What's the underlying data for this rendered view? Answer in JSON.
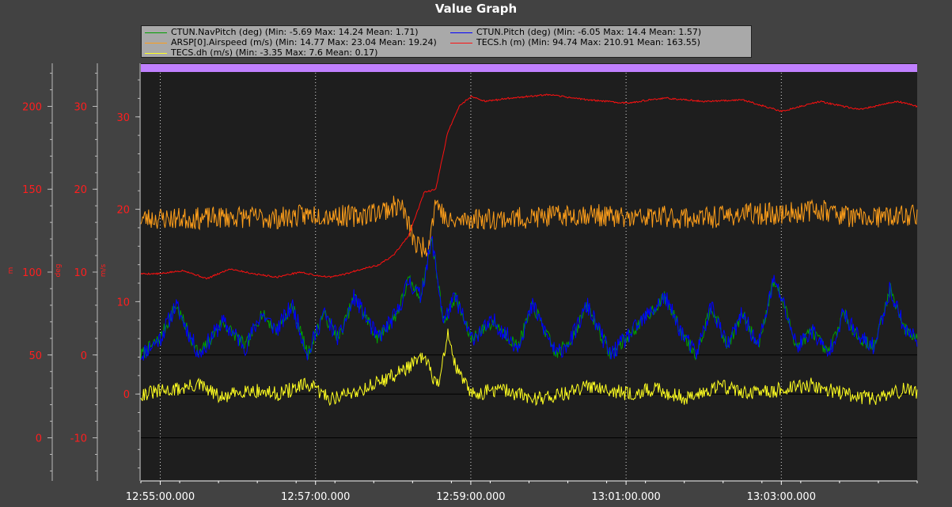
{
  "window": {
    "title": "Value Graph"
  },
  "colors": {
    "background": "#424242",
    "plot_bg": "#1e1e1e",
    "grid": "#d8d8d8",
    "axis_text": "#ff1e1e",
    "x_text": "#ffffff",
    "purple_band": "#c080ff"
  },
  "legend": [
    {
      "text": "CTUN.NavPitch (deg)  (Min: -5.69 Max: 14.24 Mean: 1.71)",
      "color": "#00a000"
    },
    {
      "text": "CTUN.Pitch (deg)  (Min: -6.05 Max: 14.4 Mean: 1.57)",
      "color": "#0000ff"
    },
    {
      "text": "ARSP[0].Airspeed (m/s)  (Min: 14.77 Max: 23.04 Mean: 19.24)",
      "color": "#ff9f1a"
    },
    {
      "text": "TECS.h (m)  (Min: 94.74 Max: 210.91 Mean: 163.55)",
      "color": "#ff1010"
    },
    {
      "text": "TECS.dh (m/s)  (Min: -3.35 Max: 7.6 Mean: 0.17)",
      "color": "#ffff20"
    }
  ],
  "chart_data": {
    "type": "line",
    "title": "Value Graph",
    "x_labels": [
      "12:55:00.000",
      "12:57:00.000",
      "12:59:00.000",
      "13:01:00.000",
      "13:03:00.000"
    ],
    "x_label_minutes": [
      0,
      2,
      4,
      6,
      8
    ],
    "x_range_minutes": [
      -0.25,
      9.75
    ],
    "axes": {
      "m": {
        "label": "m",
        "ticks": [
          0,
          50,
          100,
          150,
          200
        ],
        "range": [
          -26,
          226
        ]
      },
      "deg": {
        "label": "deg",
        "ticks": [
          -10,
          0,
          10,
          20,
          30
        ],
        "range": [
          -15.2,
          35.2
        ]
      },
      "m/s": {
        "label": "m/s",
        "ticks": [
          0,
          10,
          20,
          30
        ],
        "range": [
          -9.4,
          35.8
        ]
      }
    },
    "series": [
      {
        "name": "CTUN.NavPitch (deg)",
        "axis": "deg",
        "color": "#00a000",
        "noise": 0.8,
        "seed": 7,
        "t": [
          -0.25,
          0.0,
          0.2,
          0.5,
          0.8,
          1.1,
          1.3,
          1.5,
          1.7,
          1.9,
          2.1,
          2.3,
          2.5,
          2.8,
          3.05,
          3.2,
          3.35,
          3.5,
          3.65,
          3.8,
          4.0,
          4.3,
          4.6,
          4.8,
          5.1,
          5.3,
          5.5,
          5.8,
          6.0,
          6.3,
          6.5,
          6.7,
          6.9,
          7.1,
          7.3,
          7.5,
          7.7,
          7.9,
          8.0,
          8.2,
          8.4,
          8.6,
          8.8,
          9.0,
          9.2,
          9.4,
          9.6,
          9.75
        ],
        "v": [
          0,
          2,
          6,
          0,
          4,
          1,
          5,
          3,
          6,
          0,
          5,
          2,
          7,
          2,
          5,
          9,
          7,
          14,
          4,
          7,
          2,
          4,
          1,
          6,
          0,
          2,
          6,
          0,
          2,
          5,
          7,
          3,
          0,
          6,
          1,
          5,
          1,
          9,
          7,
          1,
          3,
          0,
          5,
          2,
          1,
          8,
          3,
          2
        ]
      },
      {
        "name": "CTUN.Pitch (deg)",
        "axis": "deg",
        "color": "#0000ff",
        "noise": 1.1,
        "seed": 11,
        "t": [
          -0.25,
          0.0,
          0.2,
          0.5,
          0.8,
          1.1,
          1.3,
          1.5,
          1.7,
          1.9,
          2.1,
          2.3,
          2.5,
          2.8,
          3.05,
          3.2,
          3.35,
          3.5,
          3.65,
          3.8,
          4.0,
          4.3,
          4.6,
          4.8,
          5.1,
          5.3,
          5.5,
          5.8,
          6.0,
          6.3,
          6.5,
          6.7,
          6.9,
          7.1,
          7.3,
          7.5,
          7.7,
          7.9,
          8.0,
          8.2,
          8.4,
          8.6,
          8.8,
          9.0,
          9.2,
          9.4,
          9.6,
          9.75
        ],
        "v": [
          0,
          2,
          6,
          0,
          4,
          1,
          5,
          3,
          6,
          0,
          5,
          2,
          7,
          2,
          5,
          9,
          7,
          14,
          4,
          7,
          2,
          4,
          1,
          6,
          0,
          2,
          6,
          0,
          2,
          5,
          7,
          3,
          0,
          6,
          1,
          5,
          1,
          9,
          7,
          1,
          3,
          0,
          5,
          2,
          1,
          8,
          3,
          2
        ]
      },
      {
        "name": "ARSP[0].Airspeed (m/s)",
        "axis": "m/s",
        "color": "#ff9f1a",
        "noise": 1.2,
        "seed": 23,
        "t": [
          -0.25,
          0.5,
          1.0,
          1.5,
          2.0,
          2.5,
          2.9,
          3.1,
          3.3,
          3.45,
          3.55,
          3.7,
          4.0,
          4.5,
          5.0,
          5.5,
          6.0,
          6.5,
          7.0,
          7.5,
          8.0,
          8.5,
          9.0,
          9.5,
          9.75
        ],
        "v": [
          19,
          19,
          19.2,
          19,
          19.5,
          19.2,
          20,
          20.5,
          16,
          16,
          21,
          18.5,
          19,
          19,
          19.2,
          19.5,
          19,
          19.2,
          19,
          19.5,
          19.5,
          20,
          19,
          19.2,
          19.5
        ]
      },
      {
        "name": "TECS.h (m)",
        "axis": "m",
        "color": "#ff1010",
        "noise": 0.5,
        "seed": 5,
        "t": [
          -0.25,
          0.0,
          0.3,
          0.6,
          0.9,
          1.2,
          1.5,
          1.8,
          2.0,
          2.2,
          2.4,
          2.6,
          2.8,
          3.0,
          3.2,
          3.4,
          3.55,
          3.7,
          3.85,
          4.0,
          4.2,
          4.5,
          5.0,
          5.5,
          6.0,
          6.5,
          7.0,
          7.5,
          8.0,
          8.5,
          9.0,
          9.5,
          9.75
        ],
        "v": [
          99,
          99,
          101,
          96,
          102,
          99,
          97,
          100,
          98,
          97,
          99,
          102,
          104,
          110,
          122,
          148,
          150,
          184,
          200,
          206,
          203,
          205,
          207,
          204,
          202,
          205,
          203,
          204,
          197,
          203,
          198,
          203,
          200
        ]
      },
      {
        "name": "TECS.dh (m/s)",
        "axis": "m/s",
        "color": "#ffff20",
        "noise": 0.8,
        "seed": 31,
        "t": [
          -0.25,
          0.2,
          0.5,
          0.8,
          1.1,
          1.5,
          1.9,
          2.2,
          2.6,
          3.0,
          3.2,
          3.4,
          3.5,
          3.6,
          3.7,
          3.8,
          4.0,
          4.4,
          4.8,
          5.2,
          5.6,
          6.0,
          6.4,
          6.8,
          7.2,
          7.6,
          8.0,
          8.4,
          8.8,
          9.2,
          9.6,
          9.75
        ],
        "v": [
          0,
          0.5,
          1,
          -0.5,
          0.5,
          0,
          1,
          -0.5,
          0.5,
          2,
          3,
          4,
          2,
          1,
          7,
          3,
          0,
          0.5,
          -0.5,
          0,
          1,
          0,
          0.5,
          -0.5,
          1,
          0,
          0.5,
          1,
          0,
          -0.5,
          0.5,
          0
        ]
      }
    ],
    "h_lines": [
      {
        "axis": "m/s",
        "value": 0
      },
      {
        "axis": "deg",
        "value": 0
      },
      {
        "axis": "deg",
        "value": -10
      }
    ],
    "grid": true,
    "legend_position": "top"
  }
}
